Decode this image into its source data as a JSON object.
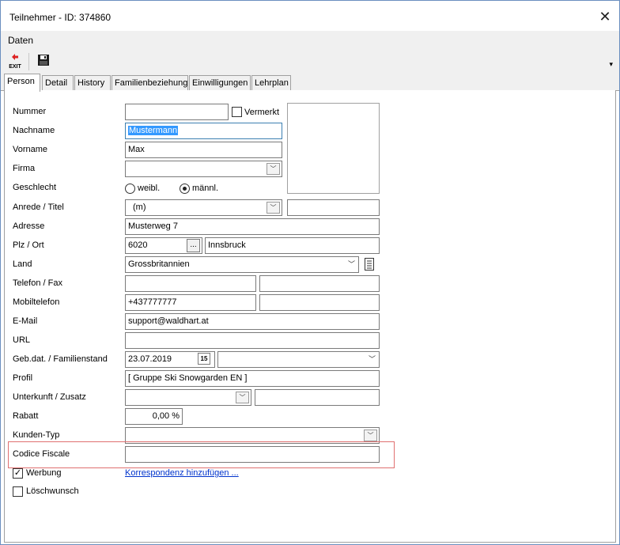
{
  "window": {
    "title": "Teilnehmer - ID: 374860"
  },
  "menu": {
    "daten": "Daten"
  },
  "toolbar": {
    "exit_label": "EXIT",
    "overflow": "▾"
  },
  "tabs": [
    {
      "label": "Person"
    },
    {
      "label": "Detail"
    },
    {
      "label": "History"
    },
    {
      "label": "Familienbeziehung"
    },
    {
      "label": "Einwilligungen"
    },
    {
      "label": "Lehrplan"
    }
  ],
  "labels": {
    "nummer": "Nummer",
    "vermerkt": "Vermerkt",
    "nachname": "Nachname",
    "vorname": "Vorname",
    "firma": "Firma",
    "geschlecht": "Geschlecht",
    "weibl": "weibl.",
    "maennl": "männl.",
    "anrede": "Anrede / Titel",
    "adresse": "Adresse",
    "plz": "Plz / Ort",
    "land": "Land",
    "telefon": "Telefon / Fax",
    "mobil": "Mobiltelefon",
    "email": "E-Mail",
    "url": "URL",
    "gebdat": "Geb.dat. / Familienstand",
    "profil": "Profil",
    "unterkunft": "Unterkunft / Zusatz",
    "rabatt": "Rabatt",
    "kundentyp": "Kunden-Typ",
    "codice": "Codice Fiscale",
    "werbung": "Werbung",
    "loeschwunsch": "Löschwunsch",
    "korrespondenz": "Korrespondenz hinzufügen ..."
  },
  "values": {
    "nummer": "",
    "nachname": "Mustermann",
    "vorname": "Max",
    "firma": "",
    "anrede": "(m)",
    "titel": "",
    "adresse": "Musterweg 7",
    "plz": "6020",
    "ort": "Innsbruck",
    "land": "Grossbritannien",
    "telefon": "",
    "fax": "",
    "mobil": "+437777777",
    "mobil2": "",
    "email": "support@waldhart.at",
    "url": "",
    "gebdat": "23.07.2019",
    "familienstand": "",
    "profil": "[ Gruppe Ski Snowgarden EN ]",
    "unterkunft": "",
    "zusatz": "",
    "rabatt": "0,00 %",
    "kundentyp": "",
    "codice": "",
    "plz_button": "...",
    "calendar_icon_text": "15"
  },
  "state": {
    "vermerkt": false,
    "geschlecht": "männl.",
    "werbung": true,
    "loeschwunsch": false
  },
  "colors": {
    "focus_border": "#3c7fb1",
    "selection": "#3399ff",
    "highlight_border": "#e07070",
    "link": "#0033cc"
  }
}
